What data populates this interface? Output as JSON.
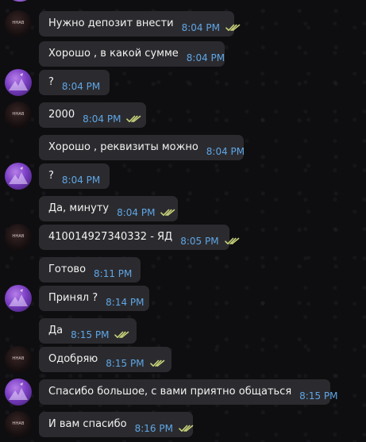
{
  "avatars": {
    "seller_label": "HHAB"
  },
  "colors": {
    "bubble": "#2b2b2f",
    "time": "#5fa6e6",
    "read_ticks": "#c9d37a",
    "background": "#0e0e10"
  },
  "messages": [
    {
      "text": "Нужно депозит внести",
      "time": "8:04 PM",
      "read": true,
      "avatar": "seller"
    },
    {
      "text": "Хорошо , в какой сумме",
      "time": "8:04 PM",
      "read": false,
      "avatar": ""
    },
    {
      "text": "?",
      "time": "8:04 PM",
      "read": false,
      "avatar": "buyer"
    },
    {
      "text": "2000",
      "time": "8:04 PM",
      "read": true,
      "avatar": "seller"
    },
    {
      "text": "Хорошо , реквизиты можно",
      "time": "8:04 PM",
      "read": false,
      "avatar": ""
    },
    {
      "text": "?",
      "time": "8:04 PM",
      "read": false,
      "avatar": "buyer"
    },
    {
      "text": "Да, минуту",
      "time": "8:04 PM",
      "read": true,
      "avatar": ""
    },
    {
      "text": "410014927340332 - ЯД",
      "time": "8:05 PM",
      "read": true,
      "avatar": "seller"
    },
    {
      "text": "Готово",
      "time": "8:11 PM",
      "read": false,
      "avatar": ""
    },
    {
      "text": "Принял ?",
      "time": "8:14 PM",
      "read": false,
      "avatar": "buyer"
    },
    {
      "text": "Да",
      "time": "8:15 PM",
      "read": true,
      "avatar": ""
    },
    {
      "text": "Одобряю",
      "time": "8:15 PM",
      "read": true,
      "avatar": "seller"
    },
    {
      "text": "Спасибо большое, с вами приятно общаться",
      "time": "8:15 PM",
      "read": false,
      "avatar": "buyer"
    },
    {
      "text": "И вам спасибо",
      "time": "8:16 PM",
      "read": true,
      "avatar": "seller"
    }
  ]
}
